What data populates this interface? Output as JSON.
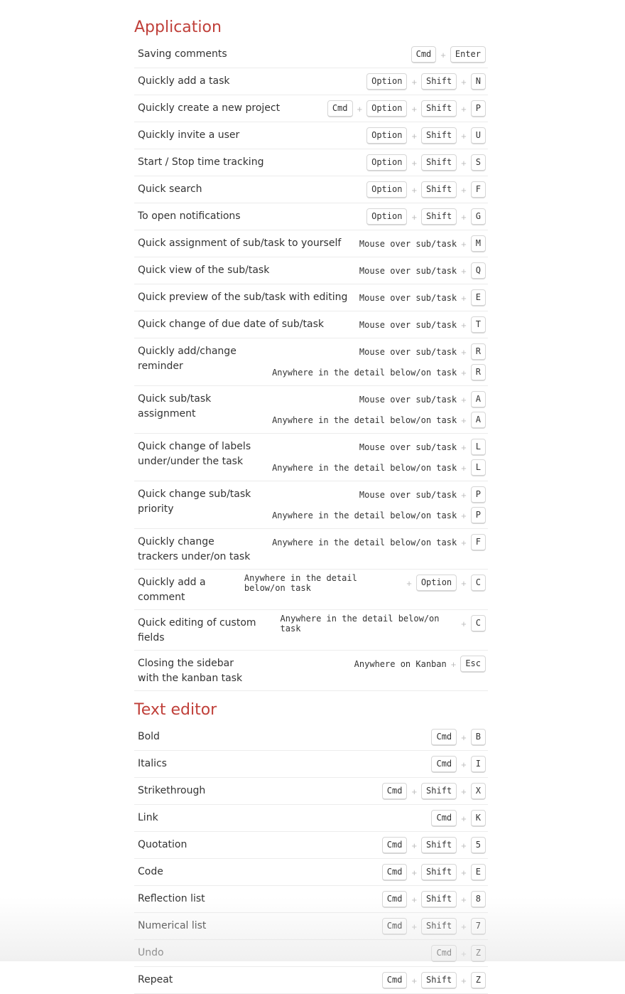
{
  "sections": [
    {
      "title": "Application",
      "rows": [
        {
          "label": "Saving comments",
          "combos": [
            [
              "Cmd",
              "+",
              "Enter"
            ]
          ]
        },
        {
          "label": "Quickly add a task",
          "combos": [
            [
              "Option",
              "+",
              "Shift",
              "+",
              "N"
            ]
          ]
        },
        {
          "label": "Quickly create a new project",
          "combos": [
            [
              "Cmd",
              "+",
              "Option",
              "+",
              "Shift",
              "+",
              "P"
            ]
          ]
        },
        {
          "label": "Quickly invite a user",
          "combos": [
            [
              "Option",
              "+",
              "Shift",
              "+",
              "U"
            ]
          ]
        },
        {
          "label": "Start / Stop time tracking",
          "combos": [
            [
              "Option",
              "+",
              "Shift",
              "+",
              "S"
            ]
          ]
        },
        {
          "label": "Quick search",
          "combos": [
            [
              "Option",
              "+",
              "Shift",
              "+",
              "F"
            ]
          ]
        },
        {
          "label": "To open notifications",
          "combos": [
            [
              "Option",
              "+",
              "Shift",
              "+",
              "G"
            ]
          ]
        },
        {
          "label": "Quick assignment of sub/task to yourself",
          "combos": [
            [
              "@Mouse over sub/task",
              "+",
              "M"
            ]
          ]
        },
        {
          "label": "Quick view of the sub/task",
          "combos": [
            [
              "@Mouse over sub/task",
              "+",
              "Q"
            ]
          ]
        },
        {
          "label": "Quick preview of the sub/task with editing",
          "combos": [
            [
              "@Mouse over sub/task",
              "+",
              "E"
            ]
          ]
        },
        {
          "label": "Quick change of due date of sub/task",
          "combos": [
            [
              "@Mouse over sub/task",
              "+",
              "T"
            ]
          ]
        },
        {
          "label": "Quickly add/change reminder",
          "combos": [
            [
              "@Mouse over sub/task",
              "+",
              "R"
            ],
            [
              "@Anywhere in the detail below/on task",
              "+",
              "R"
            ]
          ]
        },
        {
          "label": "Quick sub/task assignment",
          "combos": [
            [
              "@Mouse over sub/task",
              "+",
              "A"
            ],
            [
              "@Anywhere in the detail below/on task",
              "+",
              "A"
            ]
          ]
        },
        {
          "label": "Quick change of labels under/under the task",
          "combos": [
            [
              "@Mouse over sub/task",
              "+",
              "L"
            ],
            [
              "@Anywhere in the detail below/on task",
              "+",
              "L"
            ]
          ]
        },
        {
          "label": "Quick change sub/task priority",
          "combos": [
            [
              "@Mouse over sub/task",
              "+",
              "P"
            ],
            [
              "@Anywhere in the detail below/on task",
              "+",
              "P"
            ]
          ]
        },
        {
          "label": "Quickly change trackers under/on task",
          "combos": [
            [
              "@Anywhere in the detail below/on task",
              "+",
              "F"
            ]
          ]
        },
        {
          "label": "Quickly add a comment",
          "combos": [
            [
              "@Anywhere in the detail below/on task",
              "+",
              "Option",
              "+",
              "C"
            ]
          ]
        },
        {
          "label": "Quick editing of custom fields",
          "combos": [
            [
              "@Anywhere in the detail below/on task",
              "+",
              "C"
            ]
          ]
        },
        {
          "label": "Closing the sidebar with the kanban task",
          "combos": [
            [
              "@Anywhere on Kanban",
              "+",
              "Esc"
            ]
          ]
        }
      ]
    },
    {
      "title": "Text editor",
      "rows": [
        {
          "label": "Bold",
          "combos": [
            [
              "Cmd",
              "+",
              "B"
            ]
          ]
        },
        {
          "label": "Italics",
          "combos": [
            [
              "Cmd",
              "+",
              "I"
            ]
          ]
        },
        {
          "label": "Strikethrough",
          "combos": [
            [
              "Cmd",
              "+",
              "Shift",
              "+",
              "X"
            ]
          ]
        },
        {
          "label": "Link",
          "combos": [
            [
              "Cmd",
              "+",
              "K"
            ]
          ]
        },
        {
          "label": "Quotation",
          "combos": [
            [
              "Cmd",
              "+",
              "Shift",
              "+",
              "5"
            ]
          ]
        },
        {
          "label": "Code",
          "combos": [
            [
              "Cmd",
              "+",
              "Shift",
              "+",
              "E"
            ]
          ]
        },
        {
          "label": "Reflection list",
          "combos": [
            [
              "Cmd",
              "+",
              "Shift",
              "+",
              "8"
            ]
          ]
        },
        {
          "label": "Numerical list",
          "combos": [
            [
              "Cmd",
              "+",
              "Shift",
              "+",
              "7"
            ]
          ]
        },
        {
          "label": "Undo",
          "combos": [
            [
              "Cmd",
              "+",
              "Z"
            ]
          ]
        },
        {
          "label": "Repeat",
          "combos": [
            [
              "Cmd",
              "+",
              "Shift",
              "+",
              "Z"
            ]
          ]
        }
      ]
    }
  ]
}
